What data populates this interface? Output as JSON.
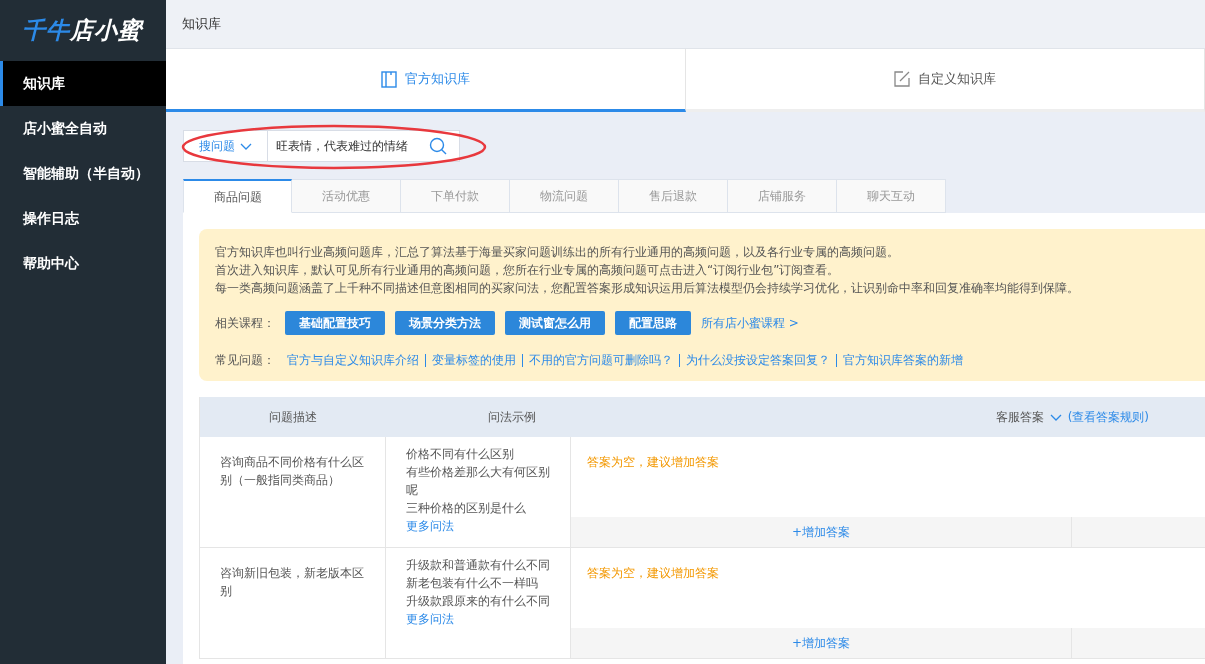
{
  "logo": {
    "brand": "千牛",
    "product": "店小蜜"
  },
  "sidebar": {
    "items": [
      {
        "label": "知识库",
        "selected": true
      },
      {
        "label": "店小蜜全自动",
        "selected": false
      },
      {
        "label": "智能辅助（半自动）",
        "selected": false
      },
      {
        "label": "操作日志",
        "selected": false
      },
      {
        "label": "帮助中心",
        "selected": false
      }
    ]
  },
  "header": {
    "title": "知识库"
  },
  "top_tabs": [
    {
      "label": "官方知识库",
      "kind": "book",
      "selected": true
    },
    {
      "label": "自定义知识库",
      "kind": "edit",
      "selected": false
    }
  ],
  "search": {
    "scope": "搜问题",
    "value": "旺表情，代表难过的情绪"
  },
  "annotation": {
    "kind": "ellipse",
    "color": "#e8383d"
  },
  "category_tabs": [
    {
      "label": "商品问题",
      "selected": true
    },
    {
      "label": "活动优惠",
      "selected": false
    },
    {
      "label": "下单付款",
      "selected": false
    },
    {
      "label": "物流问题",
      "selected": false
    },
    {
      "label": "售后退款",
      "selected": false
    },
    {
      "label": "店铺服务",
      "selected": false
    },
    {
      "label": "聊天互动",
      "selected": false
    }
  ],
  "notice": {
    "paragraphs": [
      "官方知识库也叫行业高频问题库，汇总了算法基于海量买家问题训练出的所有行业通用的高频问题，以及各行业专属的高频问题。",
      "首次进入知识库，默认可见所有行业通用的高频问题，您所在行业专属的高频问题可点击进入“订阅行业包”订阅查看。",
      "每一类高频问题涵盖了上千种不同描述但意图相同的买家问法，您配置答案形成知识运用后算法模型仍会持续学习优化，让识别命中率和回复准确率均能得到保障。"
    ],
    "courses_label": "相关课程：",
    "courses": [
      "基础配置技巧",
      "场景分类方法",
      "测试窗怎么用",
      "配置思路"
    ],
    "courses_link": "所有店小蜜课程 >",
    "faq_label": "常见问题：",
    "faq_links": [
      "官方与自定义知识库介绍",
      "变量标签的使用",
      "不用的官方问题可删除吗？",
      "为什么没按设定答案回复？",
      "官方知识库答案的新增"
    ]
  },
  "table": {
    "columns": [
      "问题描述",
      "问法示例",
      "客服答案"
    ],
    "rules_link": "(查看答案规则)",
    "rows": [
      {
        "description": "咨询商品不同价格有什么区别（一般指同类商品）",
        "examples": [
          "价格不同有什么区别",
          "有些价格差那么大有何区别呢",
          "三种价格的区别是什么"
        ],
        "more": "更多问法",
        "answer_status": "答案为空，建议增加答案",
        "add": "+增加答案"
      },
      {
        "description": "咨询新旧包装，新老版本区别",
        "examples": [
          "升级款和普通款有什么不同",
          "新老包装有什么不一样吗",
          "升级款跟原来的有什么不同"
        ],
        "more": "更多问法",
        "answer_status": "答案为空，建议增加答案",
        "add": "+增加答案"
      }
    ]
  }
}
